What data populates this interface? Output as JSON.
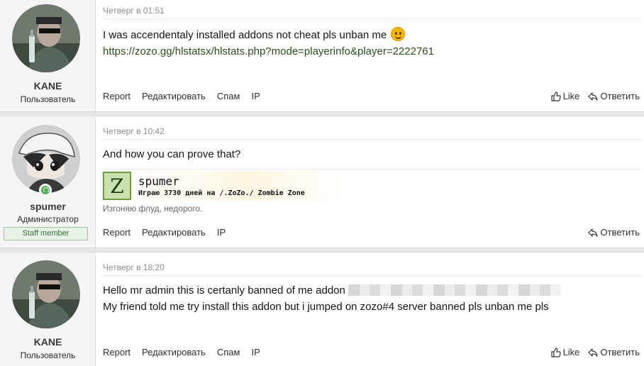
{
  "posts": [
    {
      "author": "KANE",
      "role": "Пользователь",
      "date": "Четверг в 01:51",
      "lines": [
        "I was accendentaly installed addons not cheat pls unban me"
      ],
      "link": "https://zozo.gg/hlstatsx/hlstats.php?mode=playerinfo&player=2222761",
      "actions_left": [
        "Report",
        "Редактировать",
        "Спам",
        "IP"
      ],
      "like_label": "Like",
      "reply_label": "Ответить"
    },
    {
      "author": "spumer",
      "role": "Администратор",
      "badge": "Staff member",
      "date": "Четверг в 10:42",
      "lines": [
        "And how you can prove that?"
      ],
      "signature": {
        "logo_letter": "Z",
        "name": "spumer",
        "subtitle": "Играю 3730 дней на /.ZoZo./ Zombie Zone",
        "note": "Изгоняю флуд, недорого."
      },
      "actions_left": [
        "Report",
        "Редактировать",
        "IP"
      ],
      "reply_label": "Ответить"
    },
    {
      "author": "KANE",
      "role": "Пользователь",
      "date": "Четверг в 18:20",
      "lines": [
        "Hello mr admin this is certanly banned of me addon",
        "My friend told me try install this addon but i jumped on zozo#4 server banned pls unban me pls"
      ],
      "actions_left": [
        "Report",
        "Редактировать",
        "Спам",
        "IP"
      ],
      "like_label": "Like",
      "reply_label": "Ответить"
    }
  ],
  "colors": {
    "link": "#2b4f1a",
    "online": "#4caf50",
    "staff_border": "#9bc39b"
  },
  "icons": [
    "thumbs-up-icon",
    "reply-icon",
    "smile-emoji-icon",
    "online-status-icon"
  ]
}
